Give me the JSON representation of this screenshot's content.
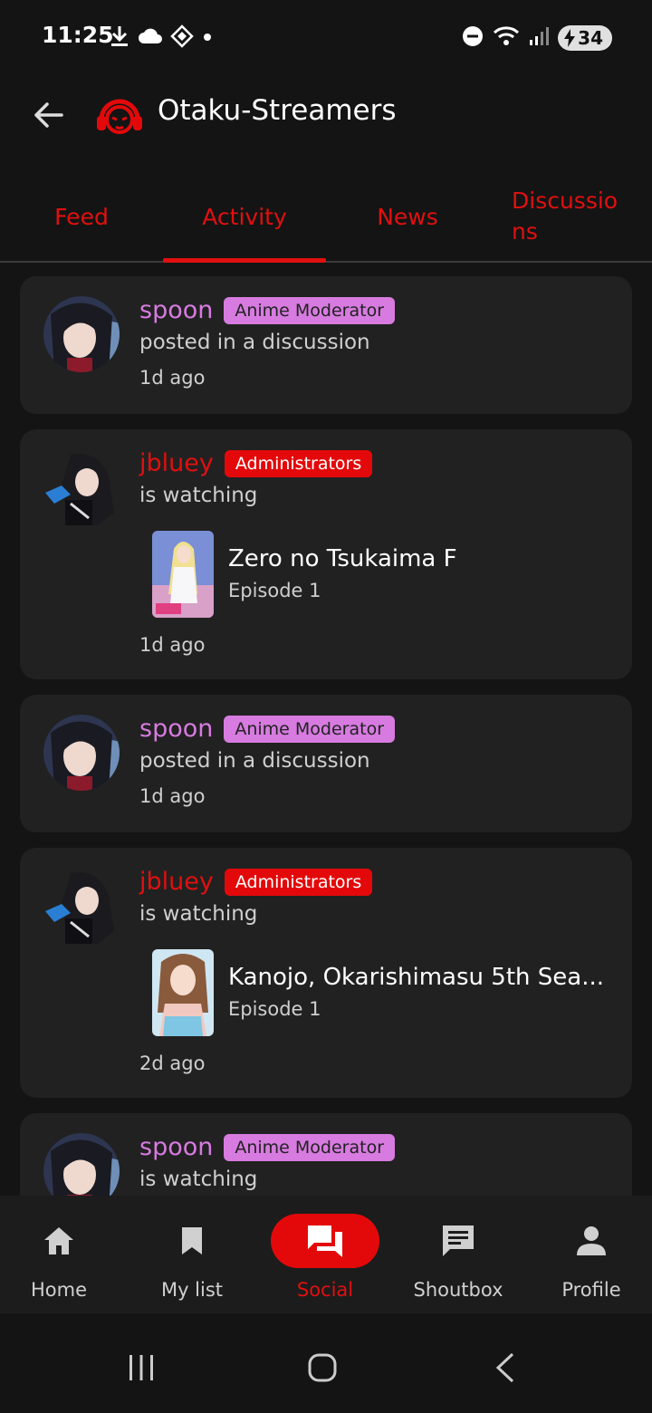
{
  "status_bar": {
    "time": "11:25",
    "battery": "34",
    "icons": [
      "download-icon",
      "cloud-icon",
      "app-icon",
      "dot-icon",
      "dnd-icon",
      "wifi-icon",
      "signal-icon",
      "battery-charging-icon"
    ]
  },
  "header": {
    "title": "Otaku-Streamers",
    "back_icon": "arrow-left-icon",
    "logo": "headphones-logo"
  },
  "tabs": [
    {
      "label": "Feed",
      "active": false
    },
    {
      "label": "Activity",
      "active": true
    },
    {
      "label": "News",
      "active": false
    },
    {
      "label": "Discussio ns",
      "line1": "Discussio",
      "line2": "ns",
      "active": false
    }
  ],
  "feed": [
    {
      "user": "spoon",
      "role": "Anime Moderator",
      "action": "posted in a discussion",
      "time": "1d ago"
    },
    {
      "user": "jbluey",
      "role": "Administrators",
      "action": "is watching",
      "media_title": "Zero no Tsukaima F",
      "media_episode": "Episode 1",
      "time": "1d ago"
    },
    {
      "user": "spoon",
      "role": "Anime Moderator",
      "action": "posted in a discussion",
      "time": "1d ago"
    },
    {
      "user": "jbluey",
      "role": "Administrators",
      "action": "is watching",
      "media_title": "Kanojo, Okarishimasu 5th Sea...",
      "media_episode": "Episode 1",
      "time": "2d ago"
    },
    {
      "user": "spoon",
      "role": "Anime Moderator",
      "action": "is watching"
    }
  ],
  "bottom_nav": [
    {
      "label": "Home",
      "icon": "home-icon",
      "active": false
    },
    {
      "label": "My list",
      "icon": "bookmark-icon",
      "active": false
    },
    {
      "label": "Social",
      "icon": "forum-icon",
      "active": true
    },
    {
      "label": "Shoutbox",
      "icon": "chat-icon",
      "active": false
    },
    {
      "label": "Profile",
      "icon": "person-icon",
      "active": false
    }
  ],
  "system_nav": [
    "recents-button",
    "home-button",
    "back-button"
  ],
  "colors": {
    "background": "#141414",
    "card": "#212121",
    "accent_red": "#e3090a",
    "moderator_pink": "#d77be0",
    "bottom_nav": "#1c1c1c"
  }
}
